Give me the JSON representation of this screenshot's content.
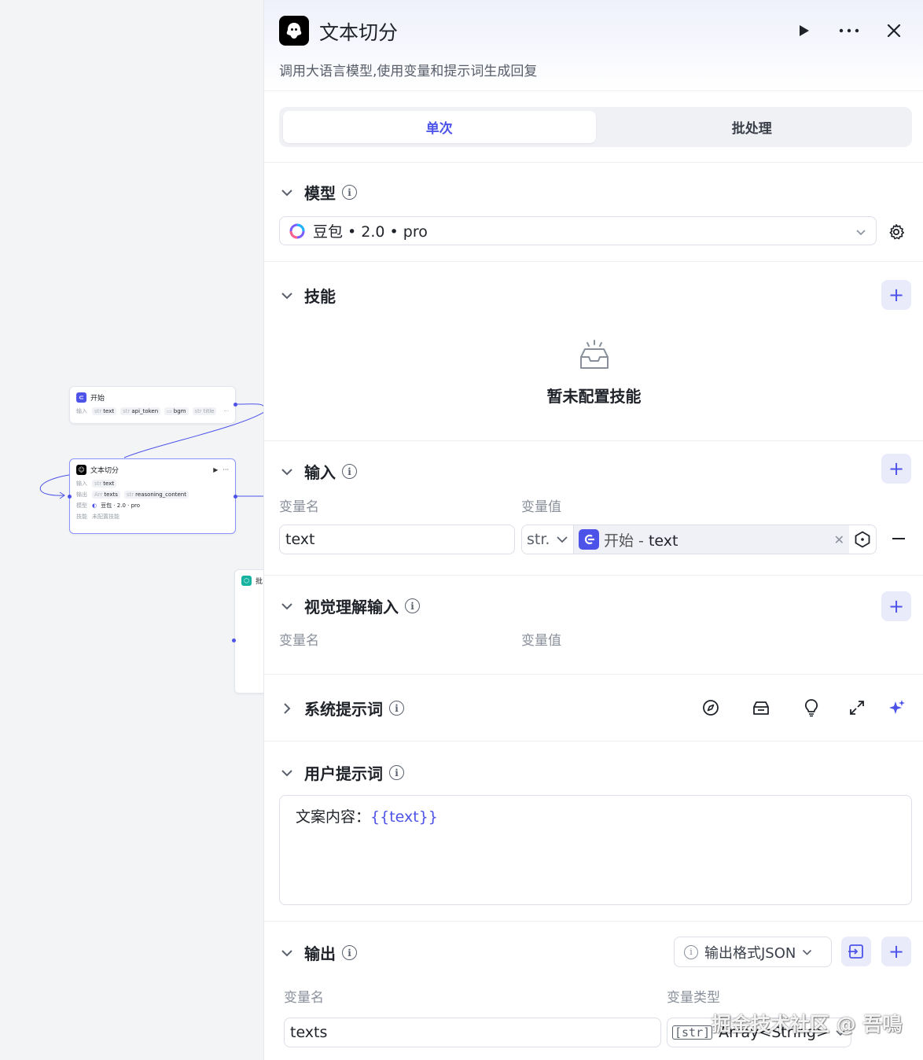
{
  "canvas": {
    "start_node": {
      "title": "开始",
      "input_label": "输入",
      "fields": [
        {
          "type": "str",
          "name": "text"
        },
        {
          "type": "str",
          "name": "api_token"
        },
        {
          "type": "",
          "name": "bgm"
        },
        {
          "type": "str",
          "name": "title"
        }
      ],
      "more": "···"
    },
    "split_node": {
      "title": "文本切分",
      "run_icon": "play-icon",
      "more": "···",
      "input_label": "输入",
      "input_field": {
        "type": "str",
        "name": "text"
      },
      "output_label": "输出",
      "output_fields": [
        {
          "type": "Arr",
          "name": "texts"
        },
        {
          "type": "str",
          "name": "reasoning_content"
        }
      ],
      "model_label": "模型",
      "model_value": "豆包 · 2.0 · pro",
      "skill_label": "技能",
      "skill_value": "未配置技能"
    },
    "partial_node": {
      "title": "批"
    }
  },
  "panel": {
    "title": "文本切分",
    "description": "调用大语言模型,使用变量和提示词生成回复",
    "tabs": [
      {
        "label": "单次",
        "active": true
      },
      {
        "label": "批处理",
        "active": false
      }
    ],
    "model": {
      "title": "模型",
      "selected": "豆包 • 2.0 • pro"
    },
    "skills": {
      "title": "技能",
      "empty_text": "暂未配置技能"
    },
    "inputs": {
      "title": "输入",
      "col_name": "变量名",
      "col_value": "变量值",
      "rows": [
        {
          "name": "text",
          "type": "str.",
          "ref_node": "开始",
          "ref_sep": " - ",
          "ref_var": "text"
        }
      ]
    },
    "vision": {
      "title": "视觉理解输入",
      "col_name": "变量名",
      "col_value": "变量值"
    },
    "system_prompt": {
      "title": "系统提示词",
      "tools": [
        "compass-icon",
        "library-icon",
        "bulb-icon",
        "expand-icon",
        "sparkle-icon"
      ]
    },
    "user_prompt": {
      "title": "用户提示词",
      "prefix": "文案内容：",
      "variable": "{{text}}"
    },
    "output": {
      "title": "输出",
      "format_button": "输出格式JSON",
      "col_name": "变量名",
      "col_type": "变量类型",
      "rows": [
        {
          "name": "texts",
          "type_badge": "[str]",
          "type": "Array<String>"
        }
      ]
    },
    "watermark": "掘金技术社区 @ 吾鳴"
  },
  "colors": {
    "accent": "#4d53e8",
    "accent_bg": "#e9ebfb",
    "border": "#dcdfe6"
  }
}
